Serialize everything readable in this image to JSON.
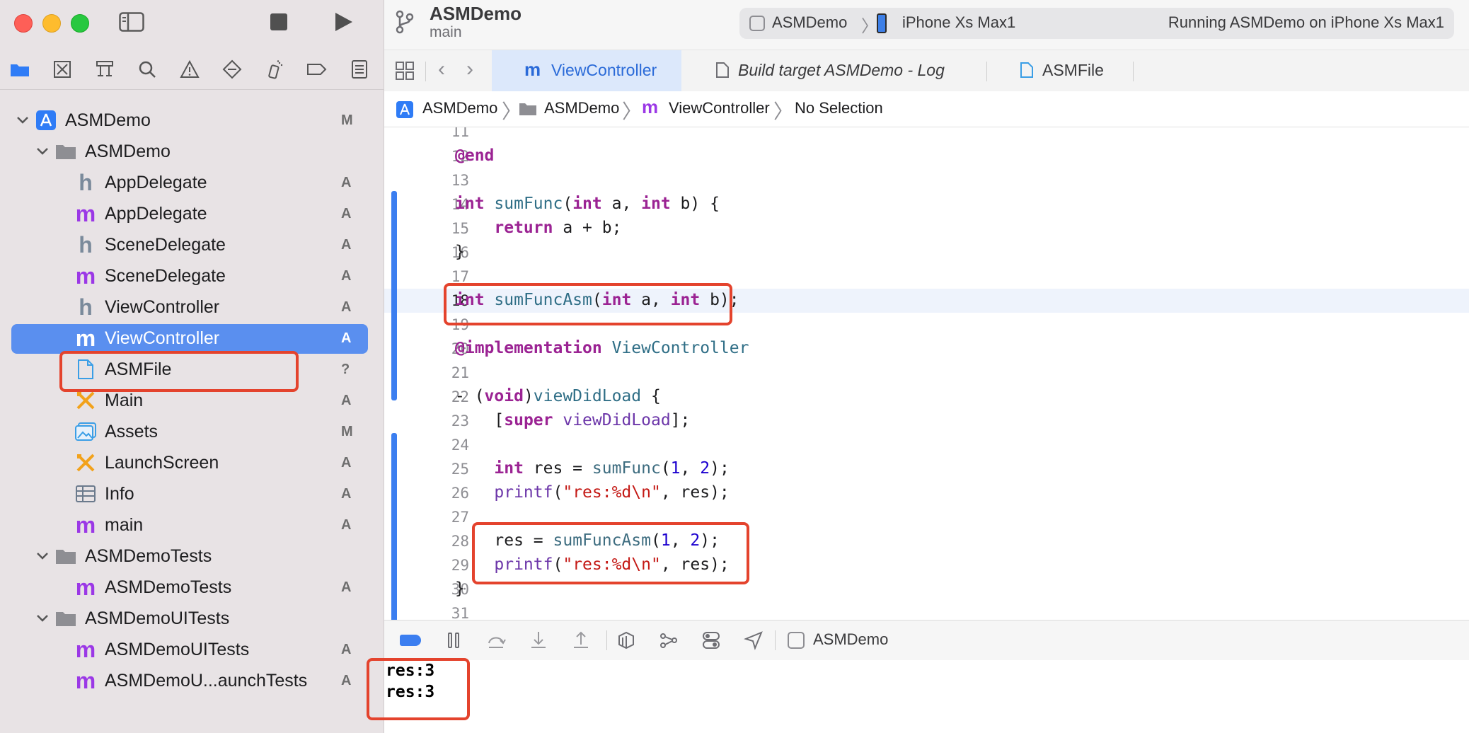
{
  "window": {
    "project_title": "ASMDemo",
    "branch": "main",
    "scheme": "ASMDemo",
    "device": "iPhone Xs Max1",
    "status": "Running ASMDemo on iPhone Xs Max1"
  },
  "navigator": {
    "tree": [
      {
        "label": "ASMDemo",
        "status": "M"
      },
      {
        "label": "ASMDemo",
        "status": ""
      },
      {
        "label": "AppDelegate",
        "status": "A",
        "icon": "h"
      },
      {
        "label": "AppDelegate",
        "status": "A",
        "icon": "m"
      },
      {
        "label": "SceneDelegate",
        "status": "A",
        "icon": "h"
      },
      {
        "label": "SceneDelegate",
        "status": "A",
        "icon": "m"
      },
      {
        "label": "ViewController",
        "status": "A",
        "icon": "h"
      },
      {
        "label": "ViewController",
        "status": "A",
        "icon": "m"
      },
      {
        "label": "ASMFile",
        "status": "?",
        "icon": "file"
      },
      {
        "label": "Main",
        "status": "A",
        "icon": "storyboard"
      },
      {
        "label": "Assets",
        "status": "M",
        "icon": "assets"
      },
      {
        "label": "LaunchScreen",
        "status": "A",
        "icon": "storyboard"
      },
      {
        "label": "Info",
        "status": "A",
        "icon": "plist"
      },
      {
        "label": "main",
        "status": "A",
        "icon": "m"
      },
      {
        "label": "ASMDemoTests",
        "status": ""
      },
      {
        "label": "ASMDemoTests",
        "status": "A",
        "icon": "m"
      },
      {
        "label": "ASMDemoUITests",
        "status": ""
      },
      {
        "label": "ASMDemoUITests",
        "status": "A",
        "icon": "m"
      },
      {
        "label": "ASMDemoU...aunchTests",
        "status": "A",
        "icon": "m"
      }
    ]
  },
  "tabs": [
    {
      "label": "ViewController",
      "icon": "m"
    },
    {
      "label": "Build target ASMDemo - Log"
    },
    {
      "label": "ASMFile"
    }
  ],
  "jumpbar": [
    "ASMDemo",
    "ASMDemo",
    "ViewController",
    "No Selection"
  ],
  "editor": {
    "line_numbers": [
      "11",
      "12",
      "13",
      "14",
      "15",
      "16",
      "17",
      "18",
      "19",
      "20",
      "21",
      "22",
      "23",
      "24",
      "25",
      "26",
      "27",
      "28",
      "29",
      "30",
      "31"
    ]
  },
  "debug": {
    "target": "ASMDemo"
  },
  "console": {
    "lines": [
      "res:3",
      "res:3"
    ]
  },
  "colors": {
    "accent": "#3b7ef0",
    "highlight_box": "#e4432d",
    "method_icon": "#9b38e6"
  }
}
